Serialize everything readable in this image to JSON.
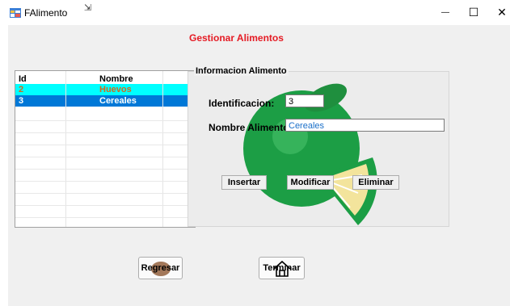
{
  "window": {
    "title": "FAlimento",
    "minimize_glyph": "—",
    "maximize_glyph": "☐",
    "close_glyph": "✕"
  },
  "form": {
    "heading": "Gestionar Alimentos",
    "heading_color": "#e51b24"
  },
  "grid": {
    "columns": [
      "Id",
      "Nombre"
    ],
    "rows": [
      {
        "id": "2",
        "nombre": "Huevos",
        "row_color": "#00ffff",
        "text_color": "#d2691e"
      },
      {
        "id": "3",
        "nombre": "Cereales",
        "row_color": "#0078d7",
        "text_color": "#ffffff"
      }
    ]
  },
  "info_group": {
    "legend": "Informacion Alimento",
    "id_label": "Identificacion:",
    "id_value": "3",
    "name_label": "Nombre  Alimento",
    "name_value": "Cereales"
  },
  "actions": {
    "insert": "Insertar",
    "modify": "Modificar",
    "delete": "Eliminar"
  },
  "footer": {
    "back": "Regresar",
    "finish": "Terminar",
    "back_icon": "potato-icon",
    "finish_icon": "house-icon"
  }
}
